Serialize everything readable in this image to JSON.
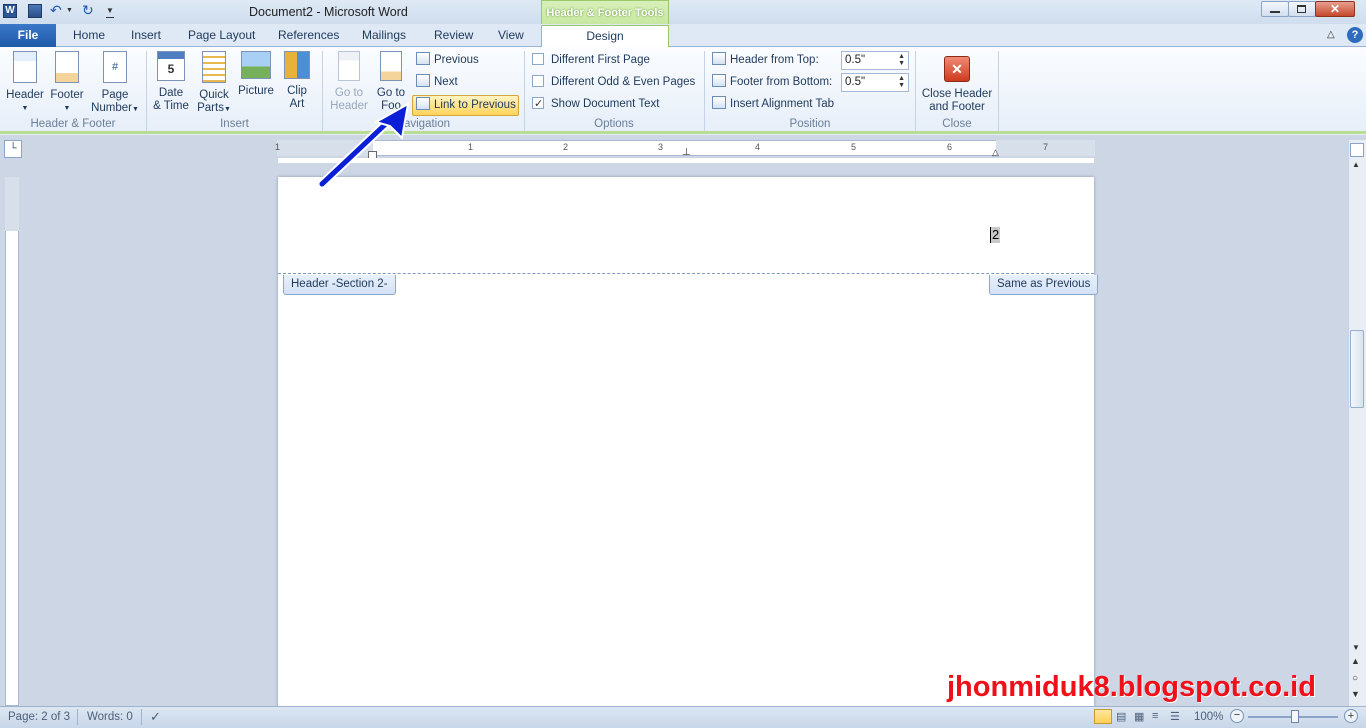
{
  "window": {
    "title": "Document2  -  Microsoft Word",
    "context_group": "Header & Footer Tools"
  },
  "tabs": [
    {
      "label": "File"
    },
    {
      "label": "Home"
    },
    {
      "label": "Insert"
    },
    {
      "label": "Page Layout"
    },
    {
      "label": "References"
    },
    {
      "label": "Mailings"
    },
    {
      "label": "Review"
    },
    {
      "label": "View"
    },
    {
      "label": "Design"
    }
  ],
  "ribbon": {
    "header_footer": {
      "label": "Header & Footer",
      "header": "Header",
      "footer": "Footer",
      "page_number_1": "Page",
      "page_number_2": "Number"
    },
    "insert": {
      "label": "Insert",
      "date_time_1": "Date",
      "date_time_2": "& Time",
      "quick_parts_1": "Quick",
      "quick_parts_2": "Parts",
      "picture": "Picture",
      "clip_art_1": "Clip",
      "clip_art_2": "Art"
    },
    "navigation": {
      "label": "avigation",
      "go_to_header_1": "Go to",
      "go_to_header_2": "Header",
      "go_to_footer_1": "Go to",
      "go_to_footer_2": "Foo",
      "previous": "Previous",
      "next": "Next",
      "link_to_previous": "Link to Previous"
    },
    "options": {
      "label": "Options",
      "different_first_page": "Different First Page",
      "different_odd_even": "Different Odd & Even Pages",
      "show_document_text": "Show Document Text",
      "show_document_text_checked": true
    },
    "position": {
      "label": "Position",
      "header_from_top": "Header from Top:",
      "header_from_top_value": "0.5\"",
      "footer_from_bottom": "Footer from Bottom:",
      "footer_from_bottom_value": "0.5\"",
      "insert_alignment_tab": "Insert Alignment Tab"
    },
    "close": {
      "label": "Close",
      "close_header_1": "Close Header",
      "close_header_2": "and Footer"
    }
  },
  "ruler": {
    "numbers": [
      "1",
      "1",
      "2",
      "3",
      "4",
      "5",
      "6",
      "7"
    ]
  },
  "document": {
    "header_tag": "Header -Section 2-",
    "same_as_previous": "Same as Previous",
    "page_number_field": "2"
  },
  "status": {
    "page": "Page: 2 of 3",
    "words": "Words: 0",
    "zoom": "100%"
  },
  "watermark": "jhonmiduk8.blogspot.co.id",
  "colors": {
    "file_tab": "#2b6cbf",
    "context_green": "#b8e089",
    "highlight": "#ffd35a",
    "annotation_arrow": "#0a1fd6",
    "watermark": "#f0101a"
  }
}
